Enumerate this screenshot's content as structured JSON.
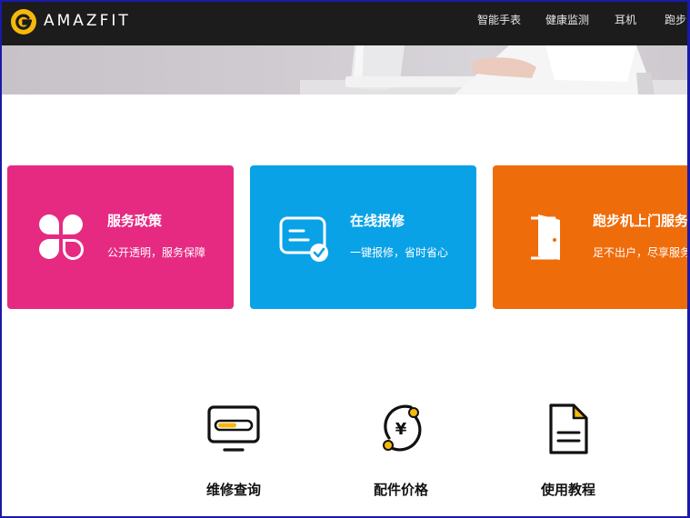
{
  "brand": {
    "name": "AMAZFIT",
    "logo_color": "#f6b80b"
  },
  "nav": {
    "items": [
      {
        "label": "智能手表"
      },
      {
        "label": "健康监测"
      },
      {
        "label": "耳机"
      },
      {
        "label": "跑步"
      }
    ]
  },
  "cards": [
    {
      "title": "服务政策",
      "subtitle": "公开透明，服务保障",
      "color": "#e62a82",
      "icon": "clover-icon"
    },
    {
      "title": "在线报修",
      "subtitle": "一键报修，省时省心",
      "color": "#0aa2e6",
      "icon": "repair-card-icon"
    },
    {
      "title": "跑步机上门服务",
      "subtitle": "足不出户，尽享服务",
      "color": "#ef6c0b",
      "icon": "door-icon"
    }
  ],
  "services": [
    {
      "label": "维修查询",
      "icon": "monitor-icon"
    },
    {
      "label": "配件价格",
      "icon": "yen-price-icon"
    },
    {
      "label": "使用教程",
      "icon": "document-icon"
    }
  ]
}
